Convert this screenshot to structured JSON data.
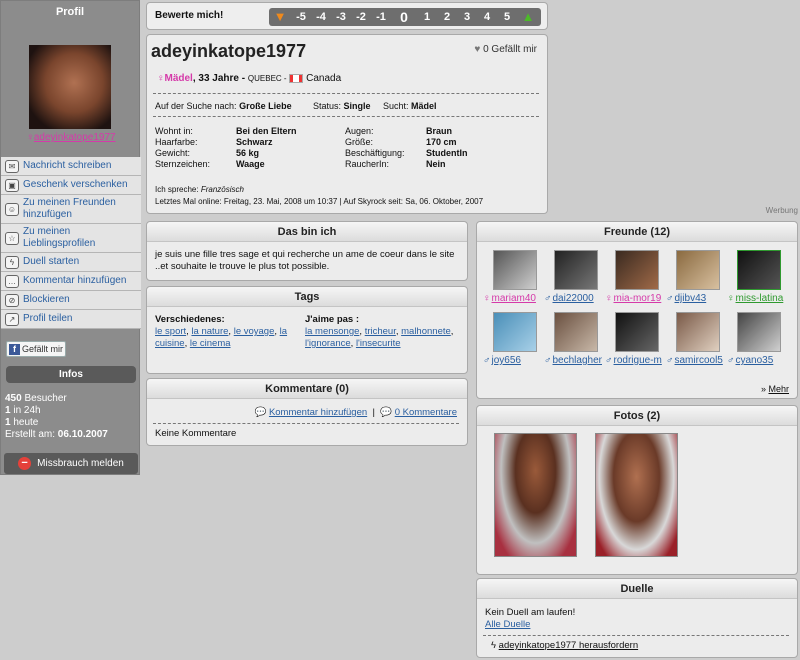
{
  "sidebar": {
    "title": "Profil",
    "username": "adeyinkatope1977",
    "actions": [
      {
        "label": "Nachricht schreiben",
        "icon": "envelope-icon"
      },
      {
        "label": "Geschenk verschenken",
        "icon": "gift-icon"
      },
      {
        "label": "Zu meinen Freunden hinzufügen",
        "icon": "add-friend-icon"
      },
      {
        "label": "Zu meinen Lieblingsprofilen",
        "icon": "star-icon"
      },
      {
        "label": "Duell starten",
        "icon": "lightning-icon"
      },
      {
        "label": "Kommentar hinzufügen",
        "icon": "comment-icon"
      },
      {
        "label": "Blockieren",
        "icon": "block-user-icon"
      },
      {
        "label": "Profil teilen",
        "icon": "share-icon"
      }
    ],
    "fb_like": "Gefällt mir",
    "infos_title": "Infos",
    "visitors_count": "450",
    "visitors_label": "Besucher",
    "in24h_count": "1",
    "in24h_label": "in 24h",
    "today_count": "1",
    "today_label": "heute",
    "created_label": "Erstellt am:",
    "created_value": "06.10.2007",
    "abuse_label": "Missbrauch melden"
  },
  "rating": {
    "label": "Bewerte mich!",
    "values": [
      "-5",
      "-4",
      "-3",
      "-2",
      "-1",
      "0",
      "1",
      "2",
      "3",
      "4",
      "5"
    ]
  },
  "profile": {
    "name": "adeyinkatope1977",
    "likes": "0 Gefällt mir",
    "gender": "Mädel",
    "age": ", 33 Jahre -",
    "region": "QUEBEC -",
    "country": "Canada",
    "search_label": "Auf der Suche nach:",
    "search_value": "Große Liebe",
    "status_label": "Status:",
    "status_value": "Single",
    "seeks_label": "Sucht:",
    "seeks_value": "Mädel",
    "lives_label": "Wohnt in:",
    "lives_value": "Bei den Eltern",
    "hair_label": "Haarfarbe:",
    "hair_value": "Schwarz",
    "weight_label": "Gewicht:",
    "weight_value": "56 kg",
    "zodiac_label": "Sternzeichen:",
    "zodiac_value": "Waage",
    "eyes_label": "Augen:",
    "eyes_value": "Braun",
    "height_label": "Größe:",
    "height_value": "170 cm",
    "job_label": "Beschäftigung:",
    "job_value": "StudentIn",
    "smoker_label": "RaucherIn:",
    "smoker_value": "Nein",
    "lang_label": "Ich spreche:",
    "lang_value": "Französisch",
    "last_online": "Letztes Mal online: Freitag, 23. Mai, 2008 um 10:37 | Auf Skyrock seit: Sa, 06. Oktober, 2007"
  },
  "werbung": "Werbung",
  "about": {
    "title": "Das bin ich",
    "text": "je suis une fille tres sage et qui recherche un ame de coeur dans le site ..et souhaite le trouve le plus tot possible."
  },
  "tags": {
    "title": "Tags",
    "left_title": "Verschiedenes:",
    "left_tags": [
      "le sport",
      "la nature",
      "le voyage",
      "la cuisine",
      "le cinema"
    ],
    "right_title": "J'aime pas :",
    "right_tags": [
      "la mensonge",
      "tricheur",
      "malhonnete",
      "l'ignorance",
      "l'insecurite"
    ]
  },
  "comments": {
    "title": "Kommentare (0)",
    "add": "Kommentar hinzufügen",
    "count_link": "0 Kommentare",
    "none": "Keine Kommentare"
  },
  "friends": {
    "title": "Freunde (12)",
    "items": [
      {
        "name": "mariam40",
        "g": "f"
      },
      {
        "name": "dai22000",
        "g": "m"
      },
      {
        "name": "mia-mor19",
        "g": "f"
      },
      {
        "name": "djibv43",
        "g": "m"
      },
      {
        "name": "miss-latina",
        "g": "g"
      },
      {
        "name": "joy656",
        "g": "m"
      },
      {
        "name": "bechlaghem",
        "g": "m"
      },
      {
        "name": "rodrigue-m",
        "g": "m"
      },
      {
        "name": "samircool5",
        "g": "m"
      },
      {
        "name": "cyano35",
        "g": "m"
      }
    ],
    "more": "Mehr"
  },
  "photos": {
    "title": "Fotos (2)"
  },
  "duels": {
    "title": "Duelle",
    "none": "Kein Duell am laufen!",
    "all": "Alle Duelle",
    "challenge": "adeyinkatope1977 herausfordern"
  }
}
